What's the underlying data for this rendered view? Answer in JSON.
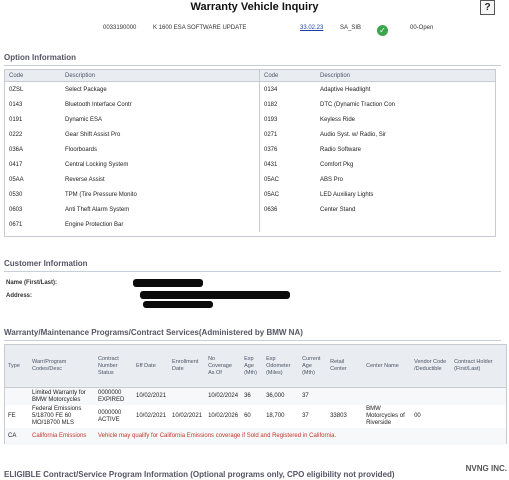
{
  "header": {
    "title": "Warranty Vehicle Inquiry",
    "help_label": "?"
  },
  "order_row": {
    "number": "0033190000",
    "description": "K 1600 ESA SOFTWARE UPDATE",
    "date": "33.02.23",
    "code": "SA_SIB",
    "status": "00-Open",
    "status_color": "#3aa64a"
  },
  "option_info": {
    "heading": "Option Information",
    "col_code": "Code",
    "col_desc": "Description",
    "left": [
      {
        "code": "0ZSL",
        "desc": "Select Package"
      },
      {
        "code": "0143",
        "desc": "Bluetooth Interface Contr"
      },
      {
        "code": "0191",
        "desc": "Dynamic ESA"
      },
      {
        "code": "0222",
        "desc": "Gear Shift Assist Pro"
      },
      {
        "code": "036A",
        "desc": "Floorboards"
      },
      {
        "code": "0417",
        "desc": "Central Locking System"
      },
      {
        "code": "05AA",
        "desc": "Reverse Assist"
      },
      {
        "code": "0530",
        "desc": "TPM (Tire Pressure Monito"
      },
      {
        "code": "0603",
        "desc": "Anti Theft Alarm System"
      },
      {
        "code": "0671",
        "desc": "Engine Protection Bar"
      }
    ],
    "right": [
      {
        "code": "0134",
        "desc": "Adaptive Headlight"
      },
      {
        "code": "0182",
        "desc": "DTC (Dynamic Traction Con"
      },
      {
        "code": "0193",
        "desc": "Keyless Ride"
      },
      {
        "code": "0271",
        "desc": "Audio Syst. w/ Radio, Sir"
      },
      {
        "code": "0376",
        "desc": "Radio Software"
      },
      {
        "code": "0431",
        "desc": "Comfort Pkg"
      },
      {
        "code": "05AC",
        "desc": "ABS Pro"
      },
      {
        "code": "05AC",
        "desc": "LED Auxiliary Lights"
      },
      {
        "code": "0636",
        "desc": "Center Stand"
      }
    ]
  },
  "customer": {
    "heading": "Customer Information",
    "name_label": "Name (First/Last):",
    "address_label": "Address:"
  },
  "warranty": {
    "heading": "Warranty/Maintenance Programs/Contract Services(Administered by BMW NA)",
    "columns": [
      "Type",
      "Warr/Program Codes/Desc",
      "Contract Number Status",
      "Eff Date",
      "Enrollment Date",
      "No Coverage As Of",
      "Exp Age (Mth)",
      "Exp Odometer (Miles)",
      "Current Age (Mth)",
      "Retail Center",
      "Center Name",
      "Vendor Code /Deductible",
      "Contract Holder (First/Last)"
    ],
    "rows": [
      {
        "type": "",
        "program": "Limited Warranty for BMW Motorcycles",
        "contract": "0000000 EXPIRED",
        "eff": "10/02/2021",
        "enroll": "",
        "nocov": "10/02/2024",
        "expage": "36",
        "expodo": "36,000",
        "curage": "37",
        "retail": "",
        "center": "",
        "vendor": "",
        "holder": ""
      },
      {
        "type": "FE",
        "program": "Federal Emissions 5/18700 FE 60 MO/18700 MLS",
        "contract": "0000000 ACTIVE",
        "eff": "10/02/2021",
        "enroll": "10/02/2021",
        "nocov": "10/02/2026",
        "expage": "60",
        "expodo": "18,700",
        "curage": "37",
        "retail": "33803",
        "center": "BMW Motorcycles of Riverside",
        "vendor": "00",
        "holder": ""
      }
    ],
    "ca_row": {
      "type": "CA",
      "program": "California Emissions",
      "note": "Vehicle may qualify for California Emissions coverage if Sold and Registered in California."
    }
  },
  "eligible": {
    "heading": "ELIGIBLE Contract/Service Program Information (Optional programs only, CPO eligibility not provided)"
  },
  "watermark": "NVNG INC."
}
